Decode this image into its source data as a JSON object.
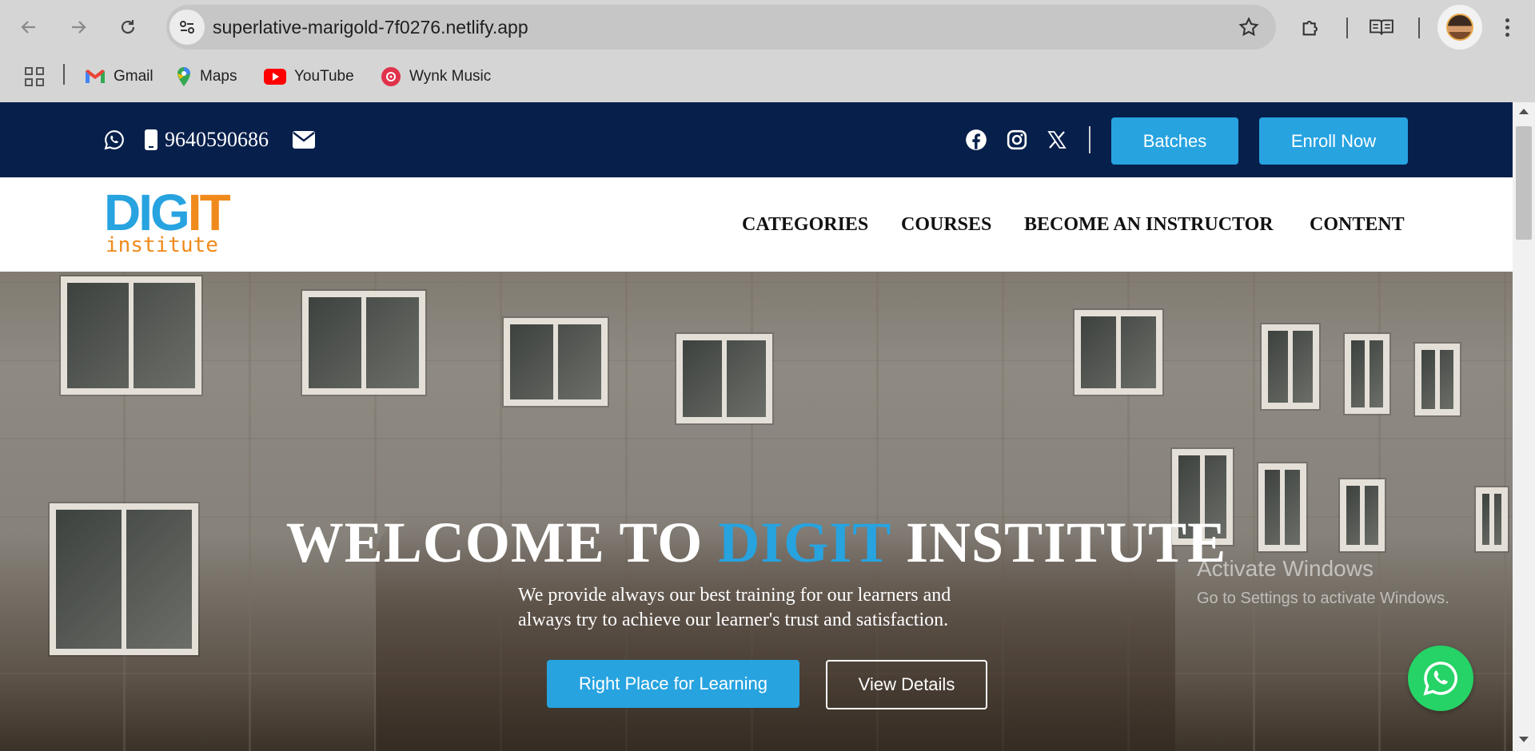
{
  "browser": {
    "url": "superlative-marigold-7f0276.netlify.app",
    "bookmarks": [
      {
        "label": "Gmail",
        "icon": "gmail-icon"
      },
      {
        "label": "Maps",
        "icon": "maps-icon"
      },
      {
        "label": "YouTube",
        "icon": "youtube-icon"
      },
      {
        "label": "Wynk Music",
        "icon": "wynk-icon"
      }
    ]
  },
  "topbar": {
    "phone": "9640590686",
    "buttons": {
      "batches": "Batches",
      "enroll": "Enroll Now"
    }
  },
  "header": {
    "logo": {
      "dig": "DIG",
      "it": "IT",
      "sub": "institute"
    },
    "menu": [
      "CATEGORIES",
      "COURSES",
      "BECOME AN INSTRUCTOR",
      "CONTENT"
    ]
  },
  "hero": {
    "title_pre": "WELCOME TO ",
    "title_highlight": "DIGIT",
    "title_post": " INSTITUTE",
    "subtitle_line1": "We provide always our best training for our learners and",
    "subtitle_line2": "always try to achieve our learner's trust and satisfaction.",
    "primary_button": "Right Place for Learning",
    "secondary_button": "View Details"
  },
  "os_overlay": {
    "activate_title": "Activate Windows",
    "activate_sub": "Go to Settings to activate Windows."
  },
  "colors": {
    "accent_blue": "#27a3e0",
    "navy": "#071f4b",
    "logo_orange": "#f08a1c",
    "whatsapp_green": "#25d366"
  }
}
